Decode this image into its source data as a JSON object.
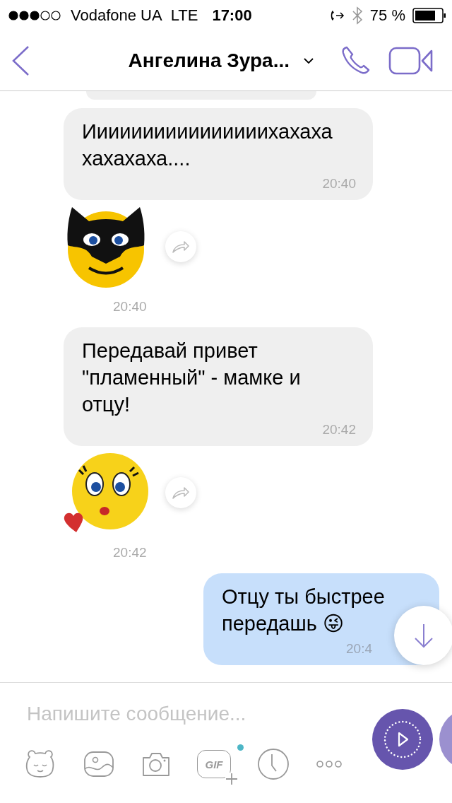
{
  "status_bar": {
    "carrier": "Vodafone UA",
    "network": "LTE",
    "time": "17:00",
    "battery": "75 %"
  },
  "header": {
    "title": "Ангелина Зура..."
  },
  "messages": [
    {
      "kind": "incoming",
      "text": "Иииииииииииииииихахаха хахахаха....",
      "time": "20:40"
    },
    {
      "kind": "mask_sticker",
      "time": "20:40"
    },
    {
      "kind": "incoming",
      "text": "Передавай привет \"пламенный\" - мамке и отцу!",
      "time": "20:42"
    },
    {
      "kind": "kiss_sticker",
      "time": "20:42"
    },
    {
      "kind": "outgoing",
      "text": "Отцу ты быстрее передашь 😜",
      "time": "20:4"
    }
  ],
  "composer": {
    "placeholder": "Напишите сообщение...",
    "gif_label": "GIF",
    "gif_new": true
  }
}
